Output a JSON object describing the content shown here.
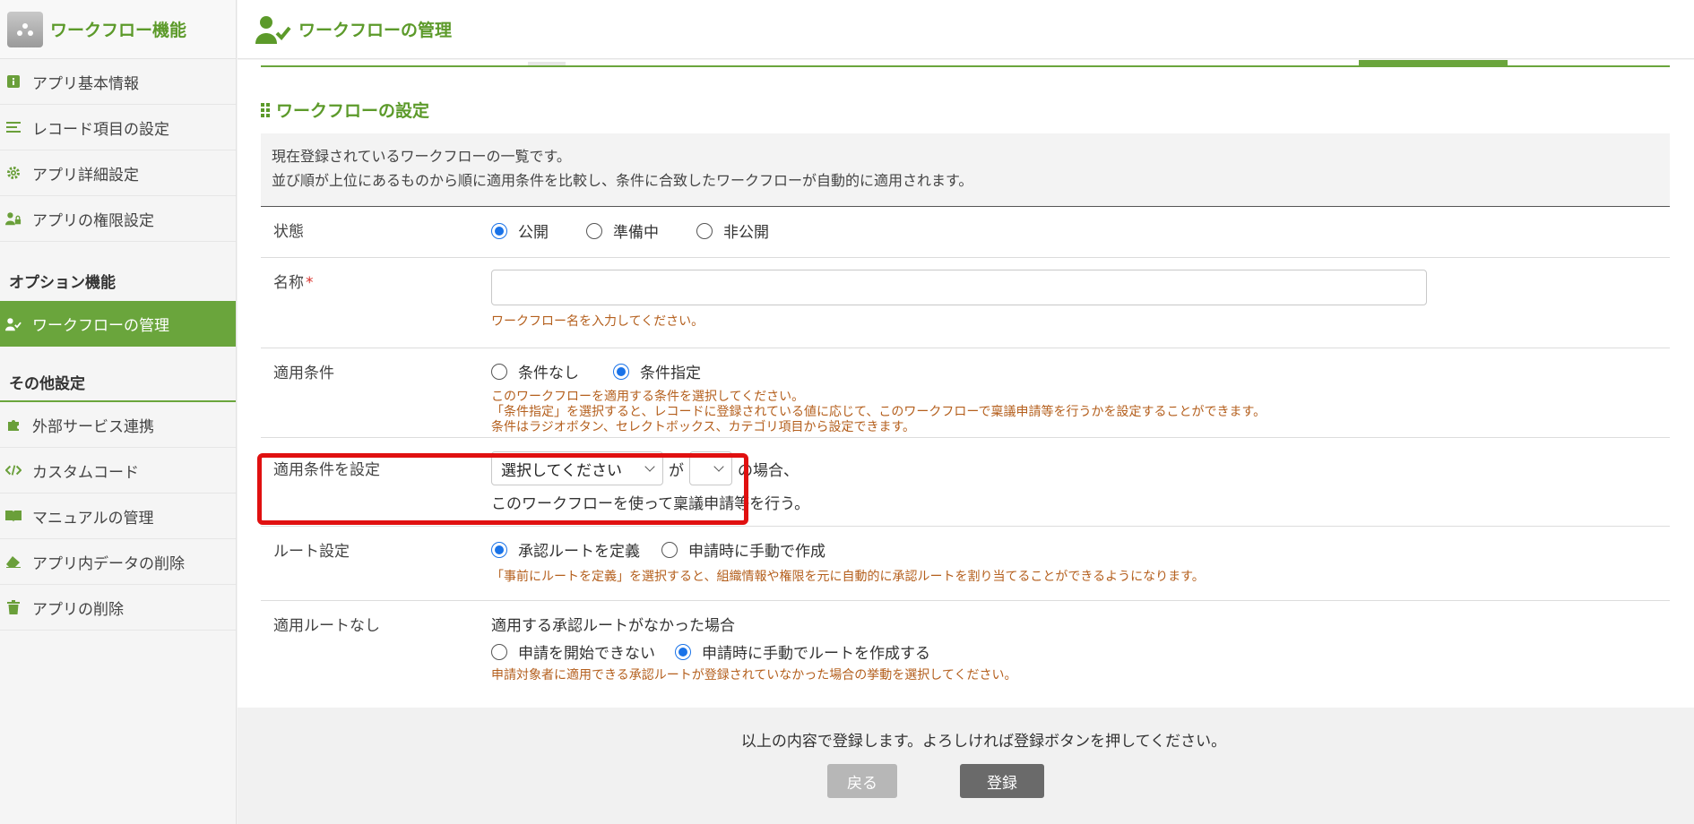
{
  "sidebar": {
    "title": "ワークフロー機能",
    "items": [
      {
        "label": "アプリ基本情報",
        "icon": "info-icon"
      },
      {
        "label": "レコード項目の設定",
        "icon": "list-icon"
      },
      {
        "label": "アプリ詳細設定",
        "icon": "gear-icon"
      },
      {
        "label": "アプリの権限設定",
        "icon": "user-lock-icon"
      }
    ],
    "option_section": "オプション機能",
    "option_items": [
      {
        "label": "ワークフローの管理",
        "icon": "user-check-icon",
        "active": true
      }
    ],
    "other_section": "その他設定",
    "other_items": [
      {
        "label": "外部サービス連携",
        "icon": "puzzle-icon"
      },
      {
        "label": "カスタムコード",
        "icon": "code-icon"
      },
      {
        "label": "マニュアルの管理",
        "icon": "book-icon"
      },
      {
        "label": "アプリ内データの削除",
        "icon": "eraser-icon"
      },
      {
        "label": "アプリの削除",
        "icon": "trash-icon"
      }
    ]
  },
  "header": {
    "title": "ワークフローの管理",
    "accent": "#5c9a2a"
  },
  "main": {
    "section_title": "ワークフローの設定",
    "info_lines": [
      "現在登録されているワークフローの一覧です。",
      "並び順が上位にあるものから順に適用条件を比較し、条件に合致したワークフローが自動的に適用されます。"
    ],
    "status": {
      "label": "状態",
      "options": [
        "公開",
        "準備中",
        "非公開"
      ],
      "selected": "公開"
    },
    "name": {
      "label": "名称",
      "required_mark": "*",
      "value": "",
      "hint": "ワークフロー名を入力してください。"
    },
    "condition": {
      "label": "適用条件",
      "options": [
        "条件なし",
        "条件指定"
      ],
      "selected": "条件指定",
      "hints": [
        "このワークフローを適用する条件を選択してください。",
        "「条件指定」を選択すると、レコードに登録されている値に応じて、このワークフローで稟議申請等を行うかを設定することができます。",
        "条件はラジオボタン、セレクトボックス、カテゴリ項目から設定できます。"
      ]
    },
    "condition_setting": {
      "label": "適用条件を設定",
      "select1": "選択してください",
      "ga": "が",
      "select2": "",
      "suffix": "の場合、",
      "line2": "このワークフローを使って稟議申請等を行う。"
    },
    "route": {
      "label": "ルート設定",
      "options": [
        "承認ルートを定義",
        "申請時に手動で作成"
      ],
      "selected": "承認ルートを定義",
      "hint": "「事前にルートを定義」を選択すると、組織情報や権限を元に自動的に承認ルートを割り当てることができるようになります。"
    },
    "no_route": {
      "label": "適用ルートなし",
      "heading": "適用する承認ルートがなかった場合",
      "options": [
        "申請を開始できない",
        "申請時に手動でルートを作成する"
      ],
      "selected": "申請時に手動でルートを作成する",
      "hint": "申請対象者に適用できる承認ルートが登録されていなかった場合の挙動を選択してください。"
    }
  },
  "footer": {
    "message": "以上の内容で登録します。よろしければ登録ボタンを押してください。",
    "back_label": "戻る",
    "save_label": "登録"
  }
}
